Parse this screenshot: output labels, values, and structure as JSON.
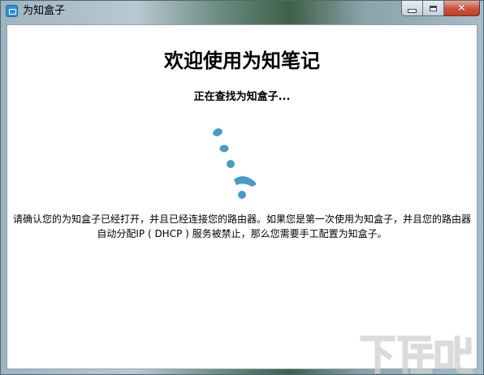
{
  "window": {
    "title": "为知盒子",
    "controls": {
      "minimize_icon": "minimize-icon",
      "maximize_icon": "maximize-icon",
      "close_icon": "close-icon",
      "close_glyph": "✕"
    }
  },
  "main": {
    "heading": "欢迎使用为知笔记",
    "status": "正在查找为知盒子...",
    "message_line1": "请确认您的为知盒子已经打开，并且已经连接您的路由器。如果您是第一次使用为知盒子，并且您的路由器",
    "message_line2": "自动分配IP ( DHCP ) 服务被禁止，那么您需要手工配置为知盒子。"
  },
  "watermark": {
    "text": "下载吧"
  },
  "colors": {
    "spinner": "#4a9ac6",
    "close_button": "#c8513e",
    "app_icon": "#2f8fd6"
  }
}
